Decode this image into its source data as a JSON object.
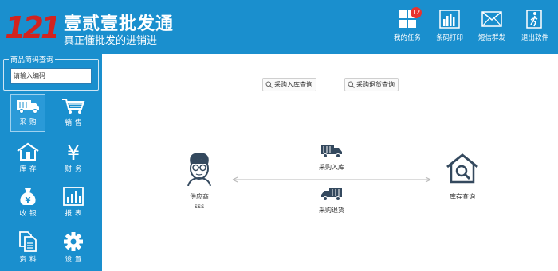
{
  "header": {
    "app_name": "壹贰壹批发通",
    "slogan": "真正懂批发的进销进",
    "tools": [
      {
        "label": "我的任务",
        "icon": "tasks-grid-icon",
        "badge": "12"
      },
      {
        "label": "条码打印",
        "icon": "barcode-chart-icon"
      },
      {
        "label": "短信群发",
        "icon": "envelope-icon"
      },
      {
        "label": "退出软件",
        "icon": "exit-door-icon"
      }
    ]
  },
  "sidebar": {
    "search_legend": "商品简码查询",
    "search_value": "请输入编码",
    "items": [
      {
        "label": "采购",
        "icon": "truck-icon"
      },
      {
        "label": "销售",
        "icon": "cart-icon"
      },
      {
        "label": "库存",
        "icon": "warehouse-icon"
      },
      {
        "label": "财务",
        "icon": "yen-icon"
      },
      {
        "label": "收银",
        "icon": "money-bag-icon"
      },
      {
        "label": "报表",
        "icon": "report-chart-icon"
      },
      {
        "label": "资料",
        "icon": "documents-icon"
      },
      {
        "label": "设置",
        "icon": "gear-icon"
      }
    ]
  },
  "main": {
    "query_buttons": [
      "采购入库查询",
      "采购退货查询"
    ],
    "supplier": {
      "label": "供应商",
      "sub": "sss"
    },
    "warehouse_label": "库存查询",
    "flow_in": "采购入库",
    "flow_return": "采购退货"
  },
  "colors": {
    "primary": "#1a8fce",
    "icon_dark": "#34495e",
    "badge": "#e8332f"
  }
}
